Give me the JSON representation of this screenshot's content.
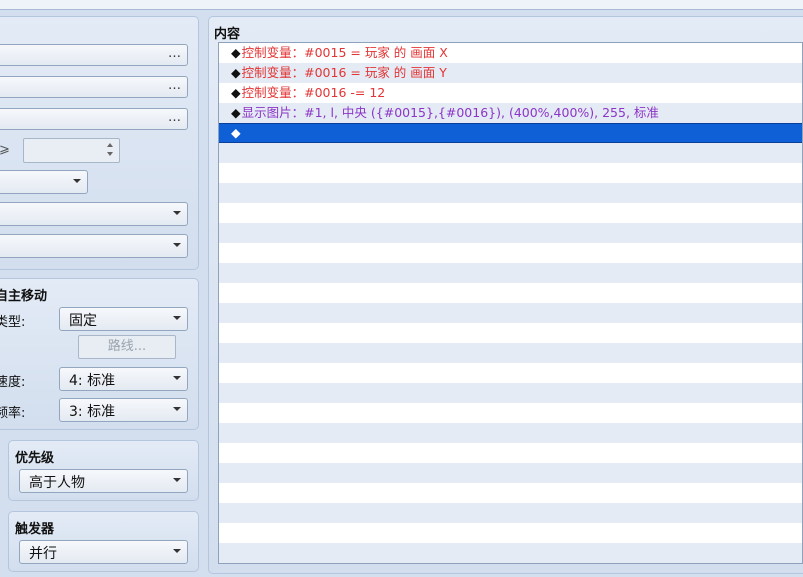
{
  "left": {
    "vehicle_field_labels": [
      "",
      "",
      ""
    ],
    "dots_label": "…",
    "compare_symbol": "⩾",
    "autonomous_movement": {
      "title": "自主移动",
      "type_label": "类型:",
      "type_value": "固定",
      "route_button": "路线...",
      "speed_label": "速度:",
      "speed_value": "4: 标准",
      "frequency_label": "频率:",
      "frequency_value": "3: 标准"
    },
    "priority": {
      "title": "优先级",
      "value": "高于人物"
    },
    "trigger": {
      "title": "触发器",
      "value": "并行"
    }
  },
  "content": {
    "title": "内容",
    "commands": [
      {
        "prefix": "◆",
        "text": "控制变量：#0015 = 玩家 的 画面 X",
        "color": "red"
      },
      {
        "prefix": "◆",
        "text": "控制变量：#0016 = 玩家 的 画面 Y",
        "color": "red"
      },
      {
        "prefix": "◆",
        "text": "控制变量：#0016 -= 12",
        "color": "red"
      },
      {
        "prefix": "◆",
        "text": "显示图片：#1, l, 中央 ({#0015},{#0016}), (400%,400%), 255, 标准",
        "color": "purple"
      },
      {
        "prefix": "◆",
        "text": "",
        "color": "selected"
      }
    ]
  }
}
